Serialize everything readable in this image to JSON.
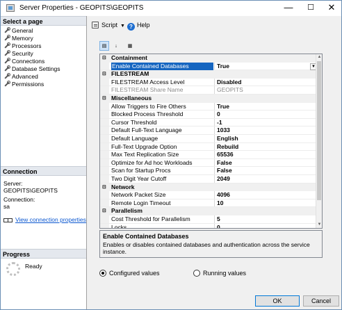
{
  "window": {
    "title": "Server Properties - GEOPITS\\GEOPITS",
    "minimize": "—",
    "maximize": "☐",
    "close": "✕"
  },
  "left_panel": {
    "select_page_heading": "Select a page",
    "pages": [
      "General",
      "Memory",
      "Processors",
      "Security",
      "Connections",
      "Database Settings",
      "Advanced",
      "Permissions"
    ],
    "connection_heading": "Connection",
    "server_label": "Server:",
    "server_value": "GEOPITS\\GEOPITS",
    "connection_label": "Connection:",
    "connection_value": "sa",
    "view_connection_link": "View connection properties",
    "progress_heading": "Progress",
    "progress_status": "Ready"
  },
  "toolbar": {
    "script_label": "Script",
    "help_label": "Help"
  },
  "grid": {
    "rows": [
      {
        "type": "category",
        "label": "Containment"
      },
      {
        "type": "property",
        "name": "Enable Contained Databases",
        "value": "True",
        "selected": true
      },
      {
        "type": "category",
        "label": "FILESTREAM"
      },
      {
        "type": "property",
        "name": "FILESTREAM Access Level",
        "value": "Disabled"
      },
      {
        "type": "property",
        "name": "FILESTREAM Share Name",
        "value": "GEOPITS",
        "dim": true
      },
      {
        "type": "category",
        "label": "Miscellaneous"
      },
      {
        "type": "property",
        "name": "Allow Triggers to Fire Others",
        "value": "True"
      },
      {
        "type": "property",
        "name": "Blocked Process Threshold",
        "value": "0"
      },
      {
        "type": "property",
        "name": "Cursor Threshold",
        "value": "-1"
      },
      {
        "type": "property",
        "name": "Default Full-Text Language",
        "value": "1033"
      },
      {
        "type": "property",
        "name": "Default Language",
        "value": "English"
      },
      {
        "type": "property",
        "name": "Full-Text Upgrade Option",
        "value": "Rebuild"
      },
      {
        "type": "property",
        "name": "Max Text Replication Size",
        "value": "65536"
      },
      {
        "type": "property",
        "name": "Optimize for Ad hoc Workloads",
        "value": "False"
      },
      {
        "type": "property",
        "name": "Scan for Startup Procs",
        "value": "False"
      },
      {
        "type": "property",
        "name": "Two Digit Year Cutoff",
        "value": "2049"
      },
      {
        "type": "category",
        "label": "Network"
      },
      {
        "type": "property",
        "name": "Network Packet Size",
        "value": "4096"
      },
      {
        "type": "property",
        "name": "Remote Login Timeout",
        "value": "10"
      },
      {
        "type": "category",
        "label": "Parallelism"
      },
      {
        "type": "property",
        "name": "Cost Threshold for Parallelism",
        "value": "5"
      },
      {
        "type": "property",
        "name": "Locks",
        "value": "0"
      }
    ]
  },
  "description": {
    "title": "Enable Contained Databases",
    "text": "Enables or disables contained databases and authentication across the service instance."
  },
  "view_mode": {
    "configured_label": "Configured values",
    "running_label": "Running values",
    "selected": "configured"
  },
  "buttons": {
    "ok": "OK",
    "cancel": "Cancel"
  }
}
